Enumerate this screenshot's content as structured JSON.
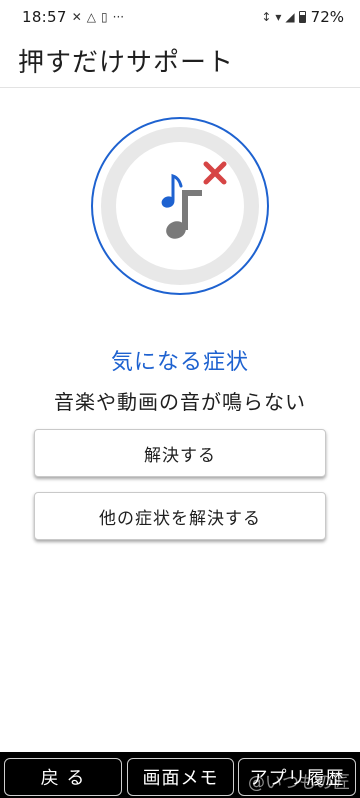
{
  "status_bar": {
    "time": "18:57",
    "battery": "72%",
    "icons": [
      "close-icon",
      "drive-icon",
      "phone-icon",
      "more-icon",
      "vibrate-icon",
      "wifi-icon",
      "signal-icon",
      "battery-icon"
    ]
  },
  "header": {
    "title": "押すだけサポート"
  },
  "hero": {
    "icon": "music-note-muted-icon",
    "colors": {
      "ring": "#1e62d0",
      "note_blue": "#1e62d0",
      "note_gray": "#7a7a7a",
      "cross": "#d64545",
      "disc": "#e8e8e8"
    }
  },
  "symptom": {
    "label": "気になる症状",
    "text": "音楽や動画の音が鳴らない"
  },
  "actions": {
    "solve": "解決する",
    "other": "他の症状を解決する"
  },
  "bottom_nav": {
    "back": "戻 る",
    "memo": "画面メモ",
    "history": "アプリ履歴"
  },
  "watermark": "@いつもの匠",
  "colors": {
    "accent": "#1e62d0",
    "bottom_bar": "#000000"
  }
}
